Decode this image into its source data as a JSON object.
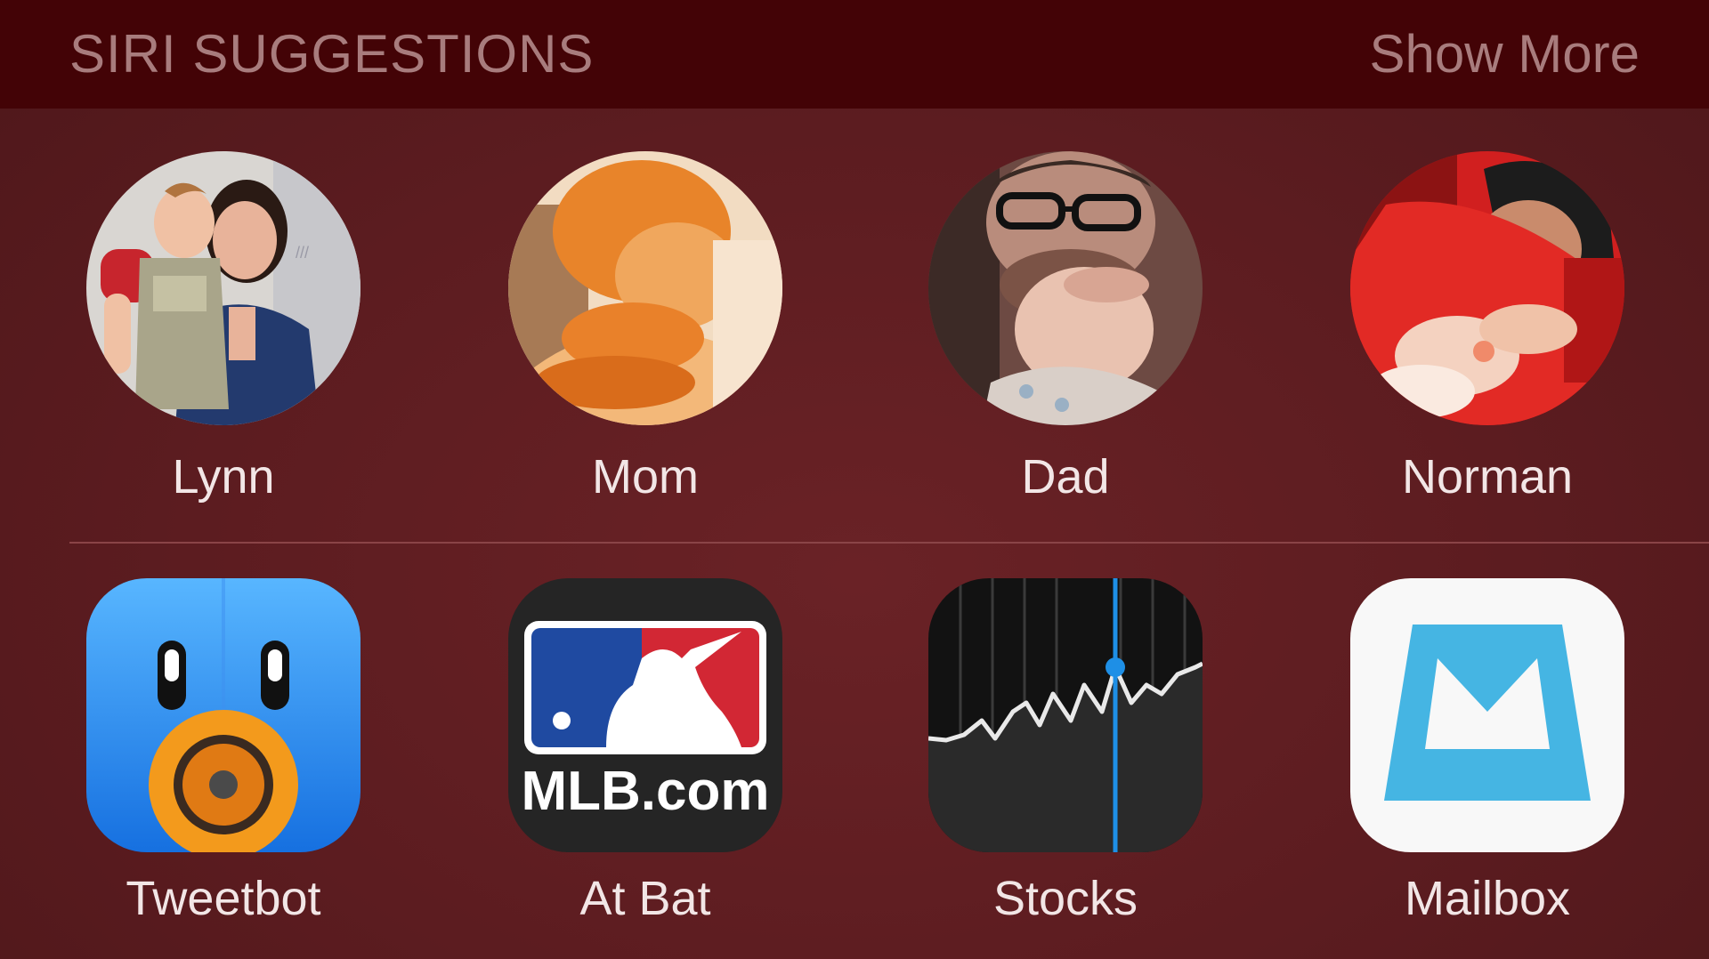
{
  "header": {
    "title": "SIRI SUGGESTIONS",
    "action": "Show More"
  },
  "contacts": [
    {
      "name": "Lynn"
    },
    {
      "name": "Mom"
    },
    {
      "name": "Dad"
    },
    {
      "name": "Norman"
    }
  ],
  "apps": [
    {
      "name": "Tweetbot",
      "icon": "tweetbot-icon"
    },
    {
      "name": "At Bat",
      "icon": "mlb-at-bat-icon",
      "icon_text": "MLB.com"
    },
    {
      "name": "Stocks",
      "icon": "stocks-icon"
    },
    {
      "name": "Mailbox",
      "icon": "mailbox-icon"
    }
  ],
  "colors": {
    "background": "#5c1c20",
    "header_background": "#430306",
    "header_text": "#a87c7d",
    "label_text": "#f2e6e6"
  }
}
